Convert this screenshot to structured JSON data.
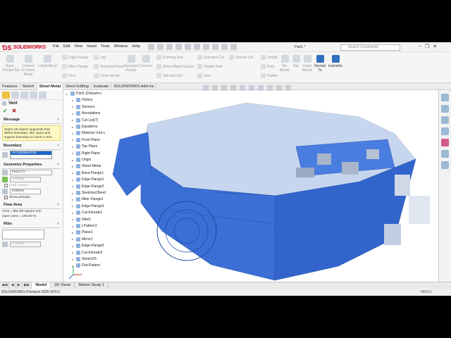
{
  "app": {
    "brand": "SOLIDWORKS",
    "doc_title": "Part1 *",
    "search_placeholder": "Search Commands"
  },
  "menus": [
    "File",
    "Edit",
    "View",
    "Insert",
    "Tools",
    "Window",
    "Help"
  ],
  "command_manager": {
    "large": [
      {
        "label": "Base\nFlange/Tab"
      },
      {
        "label": "Convert\nto Sheet\nMetal"
      },
      {
        "label": "Lofted-Bend"
      },
      {
        "label": "Sweeped\nFlange"
      },
      {
        "label": "Corners"
      },
      {
        "label": "Forming Tool"
      },
      {
        "label": "Unfold"
      },
      {
        "label": "No\nBends"
      },
      {
        "label": "Rip"
      },
      {
        "label": "Insert\nBends"
      },
      {
        "label": "Normal\nTo"
      },
      {
        "label": "Isometric"
      }
    ],
    "rows": [
      "Edge Flange",
      "Miter Flange",
      "Hem",
      "Jog",
      "Sketched Bend",
      "Cross-Break",
      "Sheet Metal Gusset",
      "Tab and Slot",
      "Extruded Cut",
      "Simple Hole",
      "Vent",
      "Normal Cut",
      "Fold",
      "Flatten"
    ]
  },
  "tabs": [
    {
      "label": "Features",
      "active": false
    },
    {
      "label": "Sketch",
      "active": false
    },
    {
      "label": "Sheet Metal",
      "active": true
    },
    {
      "label": "Direct Editing",
      "active": false
    },
    {
      "label": "Evaluate",
      "active": false
    },
    {
      "label": "SOLIDWORKS Add-ins",
      "active": false
    }
  ],
  "property_manager": {
    "title": "Vent",
    "message_header": "Message",
    "message": "Select 2D sketch segments that define boundary, ribs, spars and support boundary to insert a vent",
    "boundary_header": "Boundary",
    "boundary_item": "Arc1@Sketch25",
    "geometry_header": "Geometry Properties",
    "face": "Face<1>",
    "angle": "3.00deg",
    "draft_inward": "Draft inward",
    "radius": "0.00mm",
    "show_preview": "Show preview",
    "flow_header": "Flow Area",
    "area": "Area = 961.96 square mm",
    "open_area": "Open area = 100.00 %",
    "ribs_header": "Ribs",
    "rib_width": "0.75mm"
  },
  "tree": [
    {
      "label": "Part1 (Default<<",
      "indent": 0
    },
    {
      "label": "History",
      "indent": 1
    },
    {
      "label": "Sensors",
      "indent": 1
    },
    {
      "label": "Annotations",
      "indent": 1
    },
    {
      "label": "Cut-List(7)",
      "indent": 1
    },
    {
      "label": "Equations",
      "indent": 1
    },
    {
      "label": "Material <not s",
      "indent": 1
    },
    {
      "label": "Front Plane",
      "indent": 1
    },
    {
      "label": "Top Plane",
      "indent": 1
    },
    {
      "label": "Right Plane",
      "indent": 1
    },
    {
      "label": "Origin",
      "indent": 1
    },
    {
      "label": "Sheet-Metal",
      "indent": 1
    },
    {
      "label": "Base-Flange1",
      "indent": 1
    },
    {
      "label": "Edge-Flange1",
      "indent": 1
    },
    {
      "label": "Edge-Flange2",
      "indent": 1
    },
    {
      "label": "Sketched Bend",
      "indent": 1
    },
    {
      "label": "Miter Flange1",
      "indent": 1
    },
    {
      "label": "Edge-Flange3",
      "indent": 1
    },
    {
      "label": "Cut-Extrude1",
      "indent": 1
    },
    {
      "label": "Fillet1",
      "indent": 1
    },
    {
      "label": "LPattern1",
      "indent": 1
    },
    {
      "label": "Plane1",
      "indent": 1
    },
    {
      "label": "Mirror1",
      "indent": 1
    },
    {
      "label": "Edge-Flange5",
      "indent": 1
    },
    {
      "label": "Cut-Extrude2",
      "indent": 1
    },
    {
      "label": "Sketch25",
      "indent": 1
    },
    {
      "label": "Flat-Pattern",
      "indent": 1
    }
  ],
  "bottom_tabs": [
    {
      "label": "Model",
      "active": true
    },
    {
      "label": "3D Views",
      "active": false
    },
    {
      "label": "Motion Study 1",
      "active": false
    }
  ],
  "status": {
    "text": "SOLIDWORKS Premium 2020 SP0.0",
    "units": "MMGS"
  },
  "colors": {
    "model_blue": "#3b6fd6",
    "highlight_yellow": "#fff9c4",
    "brand_red": "#d0021b"
  }
}
